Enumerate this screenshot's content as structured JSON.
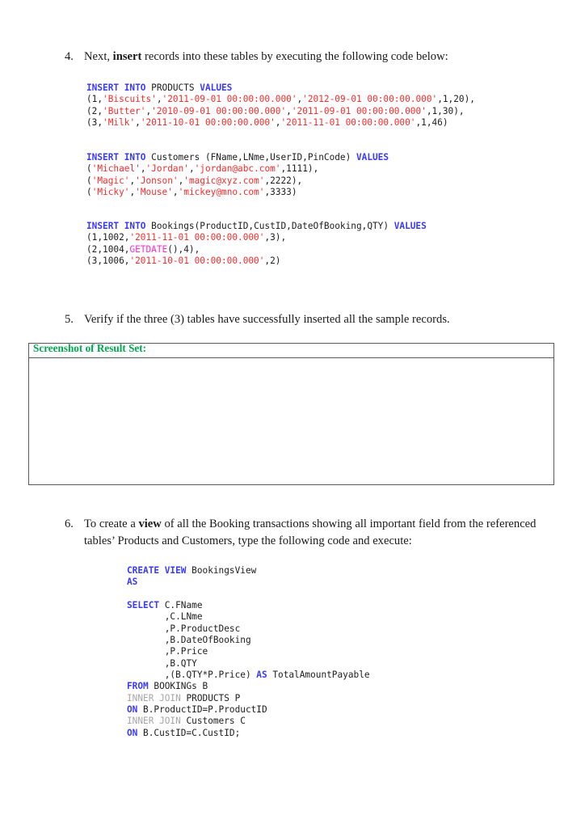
{
  "document": {
    "items": [
      {
        "number": "4.",
        "text_before": "Next, ",
        "bold": "insert",
        "text_after": " records into these tables by executing the following code below:"
      },
      {
        "number": "5.",
        "text_before": "Verify if the three (3) tables have successfully inserted all the sample records.",
        "bold": "",
        "text_after": ""
      },
      {
        "number": "6.",
        "text_before": "To create a ",
        "bold": "view",
        "text_after": " of all the Booking transactions showing all important field from the referenced tables’ Products and Customers, type the following code and execute:"
      }
    ],
    "result_set": {
      "label": "Screenshot of Result Set:",
      "label_color": "#00a84f",
      "border_color": "#595959",
      "content": ""
    },
    "code_blocks": {
      "products": {
        "lines": [
          [
            {
              "t": "INSERT INTO",
              "c": "kw"
            },
            {
              "t": " PRODUCTS ",
              "c": "plain"
            },
            {
              "t": "VALUES",
              "c": "kw"
            }
          ],
          [
            {
              "t": "(1,",
              "c": "plain"
            },
            {
              "t": "'Biscuits'",
              "c": "str"
            },
            {
              "t": ",",
              "c": "plain"
            },
            {
              "t": "'2011-09-01 00:00:00.000'",
              "c": "str"
            },
            {
              "t": ",",
              "c": "plain"
            },
            {
              "t": "'2012-09-01 00:00:00.000'",
              "c": "str"
            },
            {
              "t": ",1,20),",
              "c": "plain"
            }
          ],
          [
            {
              "t": "(2,",
              "c": "plain"
            },
            {
              "t": "'Butter'",
              "c": "str"
            },
            {
              "t": ",",
              "c": "plain"
            },
            {
              "t": "'2010-09-01 00:00:00.000'",
              "c": "str"
            },
            {
              "t": ",",
              "c": "plain"
            },
            {
              "t": "'2011-09-01 00:00:00.000'",
              "c": "str"
            },
            {
              "t": ",1,30),",
              "c": "plain"
            }
          ],
          [
            {
              "t": "(3,",
              "c": "plain"
            },
            {
              "t": "'Milk'",
              "c": "str"
            },
            {
              "t": ",",
              "c": "plain"
            },
            {
              "t": "'2011-10-01 00:00:00.000'",
              "c": "str"
            },
            {
              "t": ",",
              "c": "plain"
            },
            {
              "t": "'2011-11-01 00:00:00.000'",
              "c": "str"
            },
            {
              "t": ",1,46)",
              "c": "plain"
            }
          ]
        ]
      },
      "customers": {
        "lines": [
          [
            {
              "t": "INSERT INTO",
              "c": "kw"
            },
            {
              "t": " Customers (FName,LNme,UserID,PinCode) ",
              "c": "plain"
            },
            {
              "t": "VALUES",
              "c": "kw"
            }
          ],
          [
            {
              "t": "(",
              "c": "plain"
            },
            {
              "t": "'Michael'",
              "c": "str"
            },
            {
              "t": ",",
              "c": "plain"
            },
            {
              "t": "'Jordan'",
              "c": "str"
            },
            {
              "t": ",",
              "c": "plain"
            },
            {
              "t": "'jordan@abc.com'",
              "c": "str"
            },
            {
              "t": ",1111),",
              "c": "plain"
            }
          ],
          [
            {
              "t": "(",
              "c": "plain"
            },
            {
              "t": "'Magic'",
              "c": "str"
            },
            {
              "t": ",",
              "c": "plain"
            },
            {
              "t": "'Jonson'",
              "c": "str"
            },
            {
              "t": ",",
              "c": "plain"
            },
            {
              "t": "'magic@xyz.com'",
              "c": "str"
            },
            {
              "t": ",2222),",
              "c": "plain"
            }
          ],
          [
            {
              "t": "(",
              "c": "plain"
            },
            {
              "t": "'Micky'",
              "c": "str"
            },
            {
              "t": ",",
              "c": "plain"
            },
            {
              "t": "'Mouse'",
              "c": "str"
            },
            {
              "t": ",",
              "c": "plain"
            },
            {
              "t": "'mickey@mno.com'",
              "c": "str"
            },
            {
              "t": ",3333)",
              "c": "plain"
            }
          ]
        ]
      },
      "bookings": {
        "lines": [
          [
            {
              "t": "INSERT INTO",
              "c": "kw"
            },
            {
              "t": " Bookings(ProductID,CustID,DateOfBooking,QTY) ",
              "c": "plain"
            },
            {
              "t": "VALUES",
              "c": "kw"
            }
          ],
          [
            {
              "t": "(1,1002,",
              "c": "plain"
            },
            {
              "t": "'2011-11-01 00:00:00.000'",
              "c": "str"
            },
            {
              "t": ",3),",
              "c": "plain"
            }
          ],
          [
            {
              "t": "(2,1004,",
              "c": "plain"
            },
            {
              "t": "GETDATE",
              "c": "fn"
            },
            {
              "t": "(),4),",
              "c": "plain"
            }
          ],
          [
            {
              "t": "(3,1006,",
              "c": "plain"
            },
            {
              "t": "'2011-10-01 00:00:00.000'",
              "c": "str"
            },
            {
              "t": ",2)",
              "c": "plain"
            }
          ]
        ]
      },
      "create_view": {
        "lines": [
          [
            {
              "t": "CREATE VIEW",
              "c": "kw"
            },
            {
              "t": " BookingsView",
              "c": "plain"
            }
          ],
          [
            {
              "t": "AS",
              "c": "kw"
            }
          ],
          [
            {
              "t": "",
              "c": "plain"
            }
          ],
          [
            {
              "t": "SELECT",
              "c": "kw"
            },
            {
              "t": " C.FName",
              "c": "plain"
            }
          ],
          [
            {
              "t": "       ,C.LNme",
              "c": "plain"
            }
          ],
          [
            {
              "t": "       ,P.ProductDesc",
              "c": "plain"
            }
          ],
          [
            {
              "t": "       ,B.DateOfBooking",
              "c": "plain"
            }
          ],
          [
            {
              "t": "       ,P.Price",
              "c": "plain"
            }
          ],
          [
            {
              "t": "       ,B.QTY",
              "c": "plain"
            }
          ],
          [
            {
              "t": "       ,(B.QTY*P.Price) ",
              "c": "plain"
            },
            {
              "t": "AS",
              "c": "kw"
            },
            {
              "t": " TotalAmountPayable",
              "c": "plain"
            }
          ],
          [
            {
              "t": "FROM",
              "c": "kw"
            },
            {
              "t": " BOOKINGs B",
              "c": "plain"
            }
          ],
          [
            {
              "t": "INNER JOIN",
              "c": "gray"
            },
            {
              "t": " PRODUCTS P",
              "c": "plain"
            }
          ],
          [
            {
              "t": "ON",
              "c": "kw"
            },
            {
              "t": " B.ProductID=P.ProductID",
              "c": "plain"
            }
          ],
          [
            {
              "t": "INNER JOIN",
              "c": "gray"
            },
            {
              "t": " Customers C",
              "c": "plain"
            }
          ],
          [
            {
              "t": "ON",
              "c": "kw"
            },
            {
              "t": " B.CustID=C.CustID;",
              "c": "plain"
            }
          ]
        ]
      }
    }
  }
}
